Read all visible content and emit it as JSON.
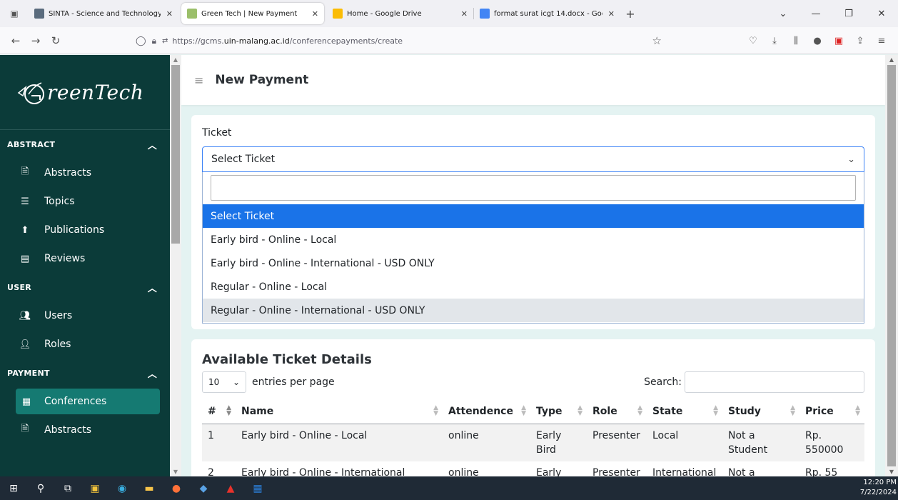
{
  "browser": {
    "tabs": [
      {
        "title": "SINTA - Science and Technology Ind",
        "color": "#5a6b7d",
        "active": false
      },
      {
        "title": "Green Tech | New Payment",
        "color": "#9bbf6a",
        "active": true
      },
      {
        "title": "Home - Google Drive",
        "color": "#fbbc04",
        "active": false
      },
      {
        "title": "format surat icgt 14.docx - Goo",
        "color": "#4285f4",
        "active": false
      }
    ],
    "url_prefix": "https://gcms.",
    "url_host": "uin-malang.ac.id",
    "url_path": "/conferencepayments/create"
  },
  "sidebar": {
    "brand": "reenTech",
    "sections": {
      "abstract": "ABSTRACT",
      "user": "USER",
      "payment": "PAYMENT"
    },
    "items": {
      "abstracts": "Abstracts",
      "topics": "Topics",
      "publications": "Publications",
      "reviews": "Reviews",
      "users": "Users",
      "roles": "Roles",
      "conferences": "Conferences",
      "payment_abstracts": "Abstracts"
    }
  },
  "header": {
    "title": "New Payment"
  },
  "ticket": {
    "label": "Ticket",
    "selected": "Select Ticket",
    "options": [
      "Select Ticket",
      "Early bird - Online - Local",
      "Early bird - Online - International - USD ONLY",
      "Regular - Online - Local",
      "Regular - Online - International - USD ONLY"
    ]
  },
  "details": {
    "title": "Available Ticket Details",
    "entries_value": "10",
    "entries_label": "entries per page",
    "search_label": "Search:",
    "columns": [
      "#",
      "Name",
      "Attendence",
      "Type",
      "Role",
      "State",
      "Study",
      "Price"
    ],
    "rows": [
      [
        "1",
        "Early bird - Online - Local",
        "online",
        "Early Bird",
        "Presenter",
        "Local",
        "Not a Student",
        "Rp. 550000"
      ],
      [
        "2",
        "Early bird - Online - International",
        "online",
        "Early",
        "Presenter",
        "International",
        "Not a",
        "Rp. 55"
      ]
    ]
  },
  "taskbar": {
    "time": "12:20 PM",
    "date": "7/22/2024"
  }
}
